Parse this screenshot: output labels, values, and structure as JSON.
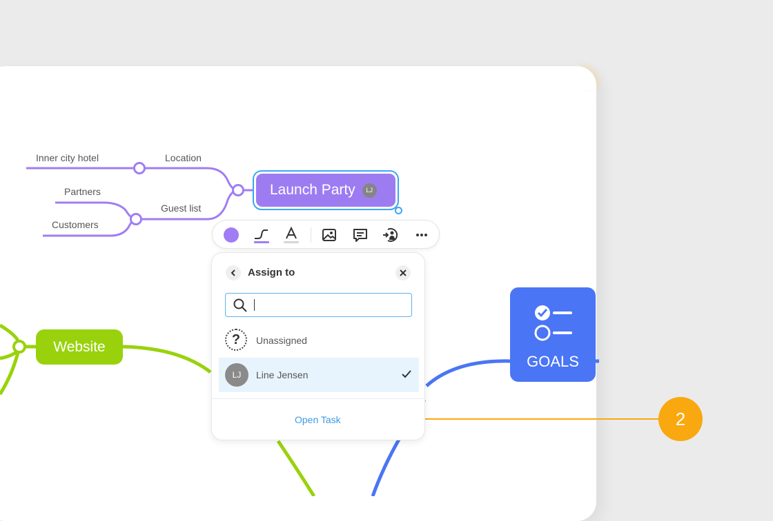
{
  "mindmap": {
    "central_node": {
      "label": "Launch Party",
      "avatar_initials": "LJ",
      "color": "#9d7cf2"
    },
    "branches": [
      "Location",
      "Guest list"
    ],
    "leaves": [
      "Inner city hotel",
      "Partners",
      "Customers"
    ],
    "website_node": {
      "label": "Website",
      "color": "#99d20c"
    },
    "goals_node": {
      "label": "GOALS",
      "icon": "checklist-icon",
      "color": "#4a75f5"
    }
  },
  "toolbar": {
    "items": [
      "color-swatch-icon",
      "branch-style-icon",
      "text-style-icon",
      "image-icon",
      "comment-icon",
      "assign-icon",
      "more-icon"
    ],
    "accent": "#a07df3"
  },
  "assign_popup": {
    "title": "Assign to",
    "search": {
      "value": "",
      "placeholder": ""
    },
    "options": [
      {
        "label": "Unassigned",
        "icon": "unassigned-icon",
        "selected": false
      },
      {
        "label": "Line Jensen",
        "initials": "LJ",
        "selected": true
      }
    ],
    "open_task_label": "Open Task"
  },
  "callout": {
    "number": "2",
    "color": "#f9a80f"
  }
}
